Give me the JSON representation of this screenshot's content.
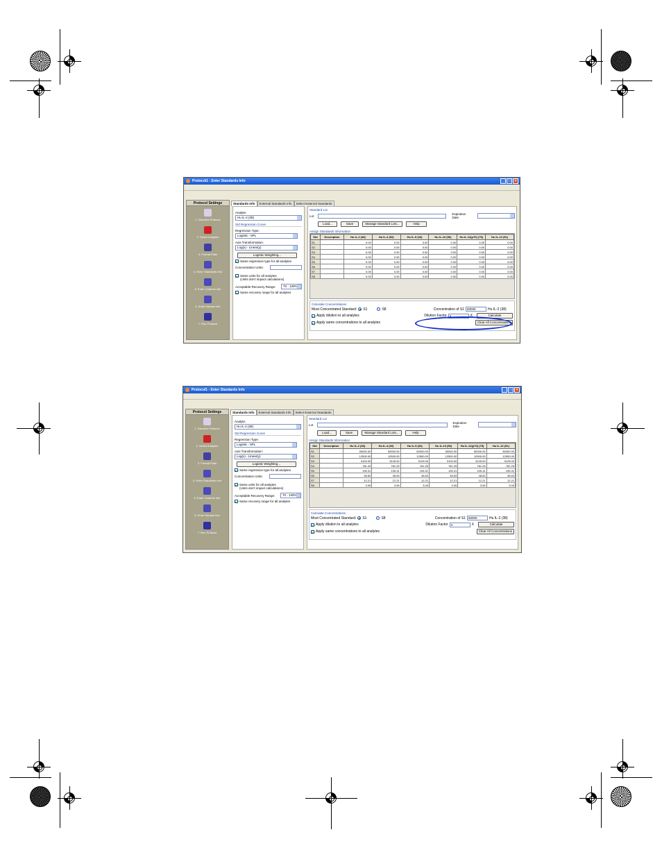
{
  "window": {
    "title": "Protocol1 - Enter Standards Info",
    "controls": [
      "_",
      "□",
      "×"
    ]
  },
  "nav": {
    "header": "Protocol Settings",
    "items": [
      {
        "label": "1. Describe Protocol",
        "icon": "document-icon",
        "color": "#d8d0e8"
      },
      {
        "label": "2. Select Analytes",
        "icon": "analytes-icon",
        "color": "#d02020"
      },
      {
        "label": "3. Format Plate",
        "icon": "plate-icon",
        "color": "#4040a0"
      },
      {
        "label": "4. Enter Standards Info",
        "icon": "standards-icon",
        "color": "#4a4ab8"
      },
      {
        "label": "5. Enter Controls Info",
        "icon": "controls-icon",
        "color": "#4a4ab8"
      },
      {
        "label": "6. Enter Sample Info",
        "icon": "sample-icon",
        "color": "#4a4ab8"
      },
      {
        "label": "7. Run Protocol",
        "icon": "run-icon",
        "color": "#3030a0"
      }
    ]
  },
  "tabs": [
    "Standards Info",
    "External Standards Info",
    "Select External Standards"
  ],
  "left": {
    "analyte_label": "Analyte:",
    "analyte_value": "Hu IL-2 (38)",
    "regression_title": "Std Regression Curve",
    "regression_type_label": "Regression Type:",
    "regression_type_value": "Logistic - 5PL",
    "axis_label": "Axis Transformation:",
    "axis_value": "Log(x) - Linear(y)",
    "logistic_button": "Logistic Weighting...",
    "same_regression": "Same regression type for all analytes",
    "conc_units_label": "Concentration Units:",
    "same_units": "Same units for all analytes",
    "same_units_note": "(Units don't impact calculations)",
    "recovery_label": "Acceptable Recovery Range:",
    "recovery_value": "70 - 130%",
    "same_recovery": "Same recovery range for all analytes"
  },
  "right": {
    "standard_lot_title": "Standard Lot",
    "lot_label": "Lot",
    "expiration_label": "Expiration Date",
    "buttons": [
      "Load...",
      "Save",
      "Manage Standard Lots...",
      "Help"
    ],
    "assign_title": "Assign Standards Information",
    "calc_title": "Calculate Concentrations",
    "most_conc_label": "Most Concentrated Standard:",
    "radio_s1": "S1",
    "radio_s8": "S8",
    "apply_dilution": "Apply dilution to all analytes",
    "apply_same": "Apply same concentrations to all analytes",
    "conc_s1_label": "Concentration of S1",
    "conc_s1_value": "50000",
    "conc_s1_unit": "Hu IL-2 (38)",
    "dilution_label": "Dilution Factor",
    "dilution_value": "4",
    "dilution_x": "X",
    "calculate_button": "Calculate",
    "clear_button": "Clear All Concentrations"
  },
  "table": {
    "headers": [
      "Std",
      "Description",
      "Hu IL-2 (38)",
      "Hu IL-4 (52)",
      "Hu IL-5 (33)",
      "Hu IL-10 (56)",
      "Hu IL-12(p70) (75)",
      "Hu IL-13 (51)"
    ],
    "slots": [
      "S1",
      "S2",
      "S3",
      "S4",
      "S5",
      "S6",
      "S7",
      "S8"
    ],
    "before": [
      [
        "0.00",
        "0.00",
        "0.00",
        "0.00",
        "0.00",
        "0.00"
      ],
      [
        "0.00",
        "0.00",
        "0.00",
        "0.00",
        "0.00",
        "0.00"
      ],
      [
        "0.00",
        "0.00",
        "0.00",
        "0.00",
        "0.00",
        "0.00"
      ],
      [
        "0.00",
        "0.00",
        "0.00",
        "0.00",
        "0.00",
        "0.00"
      ],
      [
        "0.00",
        "0.00",
        "0.00",
        "0.00",
        "0.00",
        "0.00"
      ],
      [
        "0.00",
        "0.00",
        "0.00",
        "0.00",
        "0.00",
        "0.00"
      ],
      [
        "0.00",
        "0.00",
        "0.00",
        "0.00",
        "0.00",
        "0.00"
      ],
      [
        "0.00",
        "0.00",
        "0.00",
        "0.00",
        "0.00",
        "0.00"
      ]
    ],
    "after": [
      [
        "50000.00",
        "50000.00",
        "50000.00",
        "50000.00",
        "50000.00",
        "50000.00"
      ],
      [
        "12500.00",
        "12500.00",
        "12500.00",
        "12500.00",
        "12500.00",
        "12500.00"
      ],
      [
        "3125.00",
        "3125.00",
        "3125.00",
        "3125.00",
        "3125.00",
        "3125.00"
      ],
      [
        "781.25",
        "781.25",
        "781.25",
        "781.25",
        "781.25",
        "781.25"
      ],
      [
        "195.31",
        "195.31",
        "195.31",
        "195.31",
        "195.31",
        "195.31"
      ],
      [
        "48.83",
        "48.83",
        "48.83",
        "48.83",
        "48.83",
        "48.83"
      ],
      [
        "12.21",
        "12.21",
        "12.21",
        "12.21",
        "12.21",
        "12.21"
      ],
      [
        "3.05",
        "3.05",
        "3.05",
        "3.05",
        "3.05",
        "3.05"
      ]
    ]
  },
  "colors": {
    "titlebar": "#1a5ad0",
    "nav_bg": "#a8a48c",
    "highlight": "#1030c8"
  }
}
